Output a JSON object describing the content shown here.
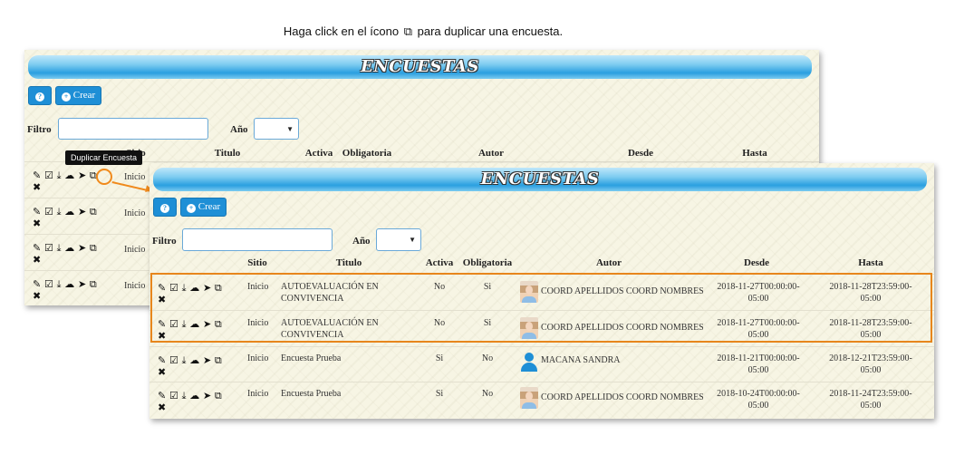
{
  "instruction": {
    "before": "Haga click en el ícono",
    "glyph": "⧉",
    "after": "para duplicar una encuesta."
  },
  "title": "ENCUESTAS",
  "buttons": {
    "help_glyph": "?",
    "create_glyph": "+",
    "create_label": "Crear"
  },
  "filters": {
    "filter_label": "Filtro",
    "filter_value": "",
    "year_label": "Año",
    "year_value": ""
  },
  "columns": {
    "sitio": "Sitio",
    "titulo": "Titulo",
    "activa": "Activa",
    "obligatoria": "Obligatoria",
    "autor": "Autor",
    "desde": "Desde",
    "hasta": "Hasta"
  },
  "action_icons": "✎ ☑ ⤓ ☁ ➤ ⧉",
  "delete_glyph": "✖",
  "tooltip": "Duplicar Encuesta",
  "back_rows": [
    {
      "sitio": "Inicio"
    },
    {
      "sitio": "Inicio"
    },
    {
      "sitio": "Inicio"
    },
    {
      "sitio": "Inicio"
    }
  ],
  "rows": [
    {
      "sitio": "Inicio",
      "titulo": "AUTOEVALUACIÓN EN CONVIVENCIA",
      "activa": "No",
      "obligatoria": "Si",
      "autor": "COORD APELLIDOS COORD NOMBRES",
      "avatar": "photo",
      "desde": "2018-11-27T00:00:00-05:00",
      "hasta": "2018-11-28T23:59:00-05:00"
    },
    {
      "sitio": "Inicio",
      "titulo": "AUTOEVALUACIÓN EN CONVIVENCIA",
      "activa": "No",
      "obligatoria": "Si",
      "autor": "COORD APELLIDOS COORD NOMBRES",
      "avatar": "photo",
      "desde": "2018-11-27T00:00:00-05:00",
      "hasta": "2018-11-28T23:59:00-05:00"
    },
    {
      "sitio": "Inicio",
      "titulo": "Encuesta Prueba",
      "activa": "Si",
      "obligatoria": "No",
      "autor": "MACANA SANDRA",
      "avatar": "user-icon",
      "desde": "2018-11-21T00:00:00-05:00",
      "hasta": "2018-12-21T23:59:00-05:00"
    },
    {
      "sitio": "Inicio",
      "titulo": "Encuesta Prueba",
      "activa": "Si",
      "obligatoria": "No",
      "autor": "COORD APELLIDOS COORD NOMBRES",
      "avatar": "photo",
      "desde": "2018-10-24T00:00:00-05:00",
      "hasta": "2018-11-24T23:59:00-05:00"
    }
  ],
  "colors": {
    "accent": "#1e8fd6",
    "highlight": "#e7861c",
    "panel_bg": "#f7f5e4"
  }
}
